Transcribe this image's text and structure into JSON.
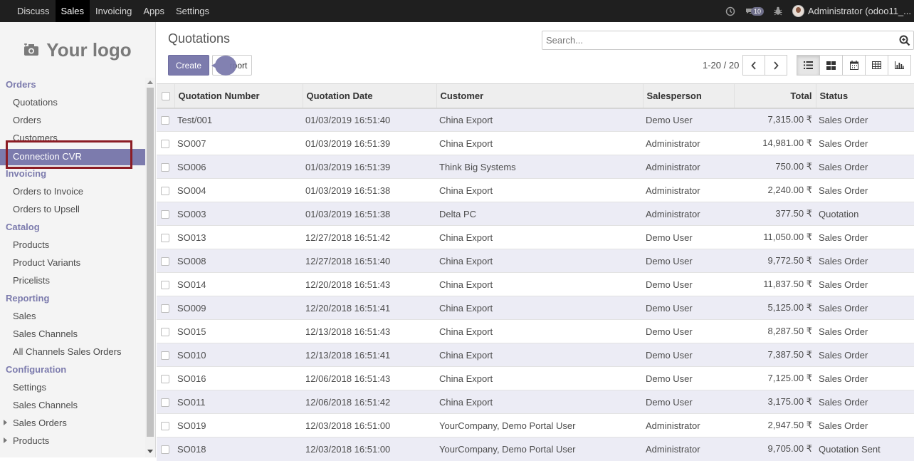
{
  "navbar": {
    "apps": [
      "Discuss",
      "Sales",
      "Invoicing",
      "Apps",
      "Settings"
    ],
    "active": "Sales",
    "chat_count": "10",
    "user": "Administrator (odoo11_..."
  },
  "sidebar": {
    "logo_text": "Your logo",
    "sections": [
      {
        "title": "Orders",
        "items": [
          "Quotations",
          "Orders",
          "Customers",
          "Connection CVR"
        ]
      },
      {
        "title": "Invoicing",
        "items": [
          "Orders to Invoice",
          "Orders to Upsell"
        ]
      },
      {
        "title": "Catalog",
        "items": [
          "Products",
          "Product Variants",
          "Pricelists"
        ]
      },
      {
        "title": "Reporting",
        "items": [
          "Sales",
          "Sales Channels",
          "All Channels Sales Orders"
        ]
      },
      {
        "title": "Configuration",
        "items": [
          "Settings",
          "Sales Channels",
          "Sales Orders",
          "Products"
        ]
      }
    ],
    "active_item": "Connection CVR"
  },
  "control": {
    "title": "Quotations",
    "search_placeholder": "Search...",
    "create_label": "Create",
    "import_label": "rport",
    "pager": "1-20 / 20"
  },
  "table": {
    "columns": [
      "Quotation Number",
      "Quotation Date",
      "Customer",
      "Salesperson",
      "Total",
      "Status"
    ],
    "rows": [
      [
        "Test/001",
        "01/03/2019 16:51:40",
        "China Export",
        "Demo User",
        "7,315.00 ₹",
        "Sales Order"
      ],
      [
        "SO007",
        "01/03/2019 16:51:39",
        "China Export",
        "Administrator",
        "14,981.00 ₹",
        "Sales Order"
      ],
      [
        "SO006",
        "01/03/2019 16:51:39",
        "Think Big Systems",
        "Administrator",
        "750.00 ₹",
        "Sales Order"
      ],
      [
        "SO004",
        "01/03/2019 16:51:38",
        "China Export",
        "Administrator",
        "2,240.00 ₹",
        "Sales Order"
      ],
      [
        "SO003",
        "01/03/2019 16:51:38",
        "Delta PC",
        "Administrator",
        "377.50 ₹",
        "Quotation"
      ],
      [
        "SO013",
        "12/27/2018 16:51:42",
        "China Export",
        "Demo User",
        "11,050.00 ₹",
        "Sales Order"
      ],
      [
        "SO008",
        "12/27/2018 16:51:40",
        "China Export",
        "Demo User",
        "9,772.50 ₹",
        "Sales Order"
      ],
      [
        "SO014",
        "12/20/2018 16:51:43",
        "China Export",
        "Demo User",
        "11,837.50 ₹",
        "Sales Order"
      ],
      [
        "SO009",
        "12/20/2018 16:51:41",
        "China Export",
        "Demo User",
        "5,125.00 ₹",
        "Sales Order"
      ],
      [
        "SO015",
        "12/13/2018 16:51:43",
        "China Export",
        "Demo User",
        "8,287.50 ₹",
        "Sales Order"
      ],
      [
        "SO010",
        "12/13/2018 16:51:41",
        "China Export",
        "Demo User",
        "7,387.50 ₹",
        "Sales Order"
      ],
      [
        "SO016",
        "12/06/2018 16:51:43",
        "China Export",
        "Demo User",
        "7,125.00 ₹",
        "Sales Order"
      ],
      [
        "SO011",
        "12/06/2018 16:51:42",
        "China Export",
        "Demo User",
        "3,175.00 ₹",
        "Sales Order"
      ],
      [
        "SO019",
        "12/03/2018 16:51:00",
        "YourCompany, Demo Portal User",
        "Administrator",
        "2,947.50 ₹",
        "Sales Order"
      ],
      [
        "SO018",
        "12/03/2018 16:51:00",
        "YourCompany, Demo Portal User",
        "Administrator",
        "9,705.00 ₹",
        "Quotation Sent"
      ]
    ]
  },
  "colors": {
    "accent": "#7c7bad",
    "navbar": "#1f1f1f",
    "highlight_border": "#8b1c24"
  }
}
